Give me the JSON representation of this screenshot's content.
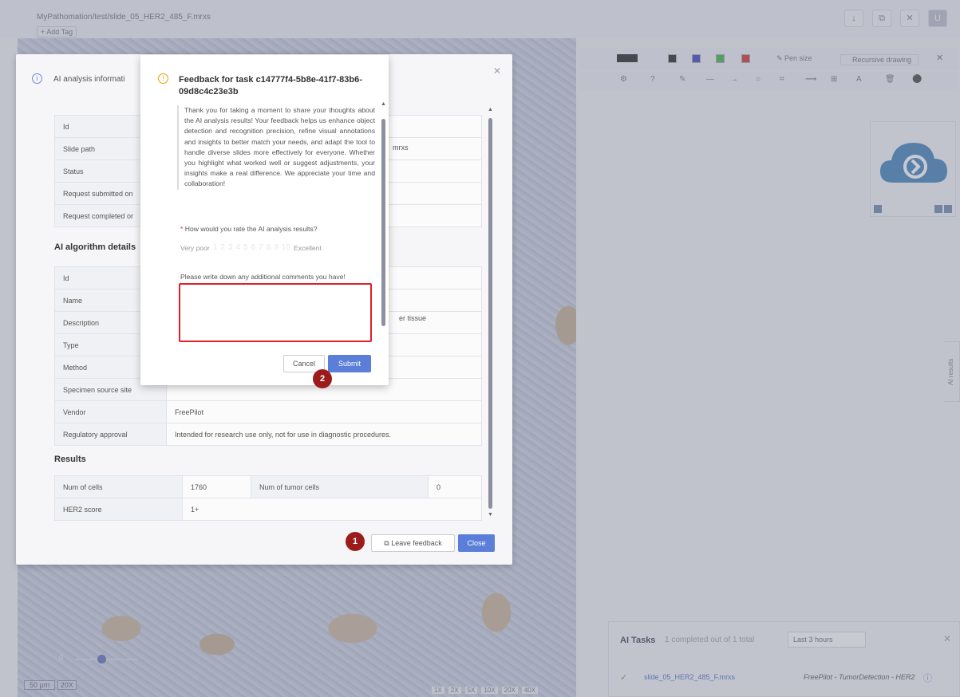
{
  "header": {
    "breadcrumb": "MyPathomation/test/slide_05_HER2_485_F.mrxs",
    "add_tag": "+ Add Tag",
    "buttons": [
      "↓",
      "⧉",
      "✕",
      "U"
    ]
  },
  "toolbar": {
    "pen_size": "Pen size",
    "recursive_drawing": "Recursive drawing",
    "colors": [
      "#222222",
      "#3a3fbf",
      "#3cb043",
      "#d12b2b"
    ],
    "tools": [
      "⚙",
      "?",
      "✎",
      "—",
      "→",
      "○",
      "⌗",
      "⟿",
      "⊞",
      "A",
      "🗑",
      "⚫"
    ]
  },
  "side_tab": {
    "label": "AI results"
  },
  "zoom": {
    "value": "0",
    "scale": "50 µm",
    "magnification": "20X"
  },
  "magnifications": [
    "1X",
    "2X",
    "5X",
    "10X",
    "20X",
    "40X"
  ],
  "ai_tasks": {
    "title": "AI Tasks",
    "summary": "1 completed out of 1 total",
    "timeframe": "Last 3 hours",
    "rows": [
      {
        "slide": "slide_05_HER2_485_F.mrxs",
        "algorithm": "FreePilot - TumorDetection - HER2"
      }
    ]
  },
  "info_modal": {
    "title": "AI analysis informati",
    "task_rows": [
      {
        "k": "Id",
        "v": ""
      },
      {
        "k": "Slide path",
        "v": ""
      },
      {
        "k": "Status",
        "v": ""
      },
      {
        "k": "Request submitted on",
        "v": ""
      },
      {
        "k": "Request completed or",
        "v": ""
      }
    ],
    "algorithm_heading": "AI algorithm details",
    "algorithm_rows": [
      {
        "k": "Id",
        "v": ""
      },
      {
        "k": "Name",
        "v": ""
      },
      {
        "k": "Description",
        "v": ""
      },
      {
        "k": "Type",
        "v": ""
      },
      {
        "k": "Method",
        "v": ""
      },
      {
        "k": "Specimen source site",
        "v": ""
      },
      {
        "k": "Vendor",
        "v": "FreePilot"
      },
      {
        "k": "Regulatory approval",
        "v": "Intended for research use only, not for use in diagnostic procedures."
      }
    ],
    "results_heading": "Results",
    "results": {
      "num_cells_label": "Num of cells",
      "num_cells": "1760",
      "num_tumor_label": "Num of tumor cells",
      "num_tumor": "0",
      "her2_label": "HER2 score",
      "her2": "1+"
    },
    "behind_text": {
      "slide_path_tail": "mrxs",
      "description_tail": "er tissue"
    },
    "leave_feedback": "Leave feedback",
    "close": "Close",
    "step_badge": "1"
  },
  "feedback_modal": {
    "title": "Feedback for task c14777f4-5b8e-41f7-83b6-09d8c4c23e3b",
    "intro": "Thank you for taking a moment to share your thoughts about the AI analysis results! Your feedback helps us enhance object detection and recognition precision, refine visual annotations and insights to better match your needs, and adapt the tool to handle diverse slides more effectively for everyone. Whether you highlight what worked well or suggest adjustments, your insights make a real difference. We appreciate your time and collaboration!",
    "rating_question": "How would you rate the AI analysis results?",
    "rating_low": "Very poor",
    "rating_high": "Excellent",
    "rating_scale": [
      "1",
      "2",
      "3",
      "4",
      "5",
      "6",
      "7",
      "8",
      "9",
      "10"
    ],
    "comments_label": "Please write down any additional comments you have!",
    "comments_value": "",
    "cancel": "Cancel",
    "submit": "Submit",
    "step_badge": "2"
  }
}
